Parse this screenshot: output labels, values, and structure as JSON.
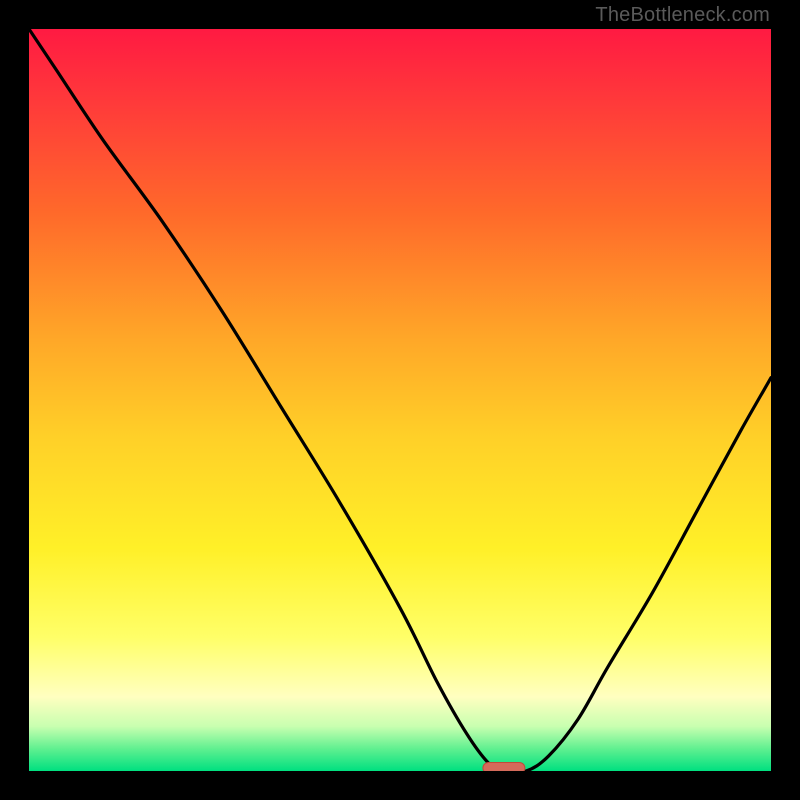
{
  "watermark": "TheBottleneck.com",
  "colors": {
    "background": "#000000",
    "curve": "#000000",
    "marker_fill": "#d46a5a",
    "marker_stroke": "#c04a3a"
  },
  "chart_data": {
    "type": "line",
    "title": "",
    "xlabel": "",
    "ylabel": "",
    "xlim": [
      0,
      100
    ],
    "ylim": [
      0,
      100
    ],
    "grid": false,
    "series": [
      {
        "name": "bottleneck-curve",
        "x": [
          0,
          4,
          10,
          18,
          26,
          34,
          42,
          50,
          55,
          59,
          62,
          64,
          67,
          70,
          74,
          78,
          84,
          90,
          96,
          100
        ],
        "values": [
          100,
          94,
          85,
          74,
          62,
          49,
          36,
          22,
          12,
          5,
          1,
          0,
          0,
          2,
          7,
          14,
          24,
          35,
          46,
          53
        ]
      }
    ],
    "marker": {
      "x": 64,
      "y": 0,
      "shape": "pill"
    },
    "legend": false
  }
}
